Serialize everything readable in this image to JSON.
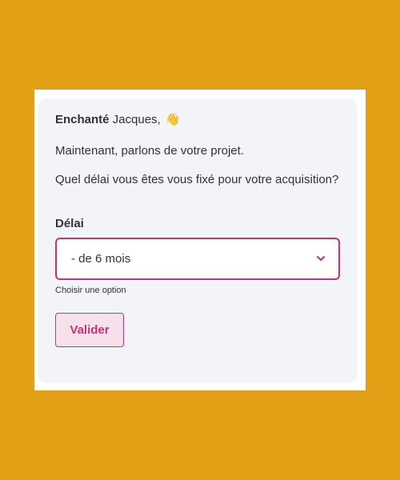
{
  "greeting": {
    "bold": "Enchanté",
    "rest": " Jacques, ",
    "emoji": "👋"
  },
  "messages": {
    "line1": "Maintenant, parlons de votre projet.",
    "line2": "Quel délai vous êtes vous fixé pour votre acquisition?"
  },
  "field": {
    "label": "Délai",
    "selected_value": "- de 6 mois",
    "help_text": "Choisir une option"
  },
  "button": {
    "label": "Valider"
  },
  "icons": {
    "select_arrow": "chevron-down-icon"
  },
  "colors": {
    "background": "#e2a017",
    "accent": "#c8317a",
    "card": "#f3f4f8",
    "text": "#2f3142"
  }
}
